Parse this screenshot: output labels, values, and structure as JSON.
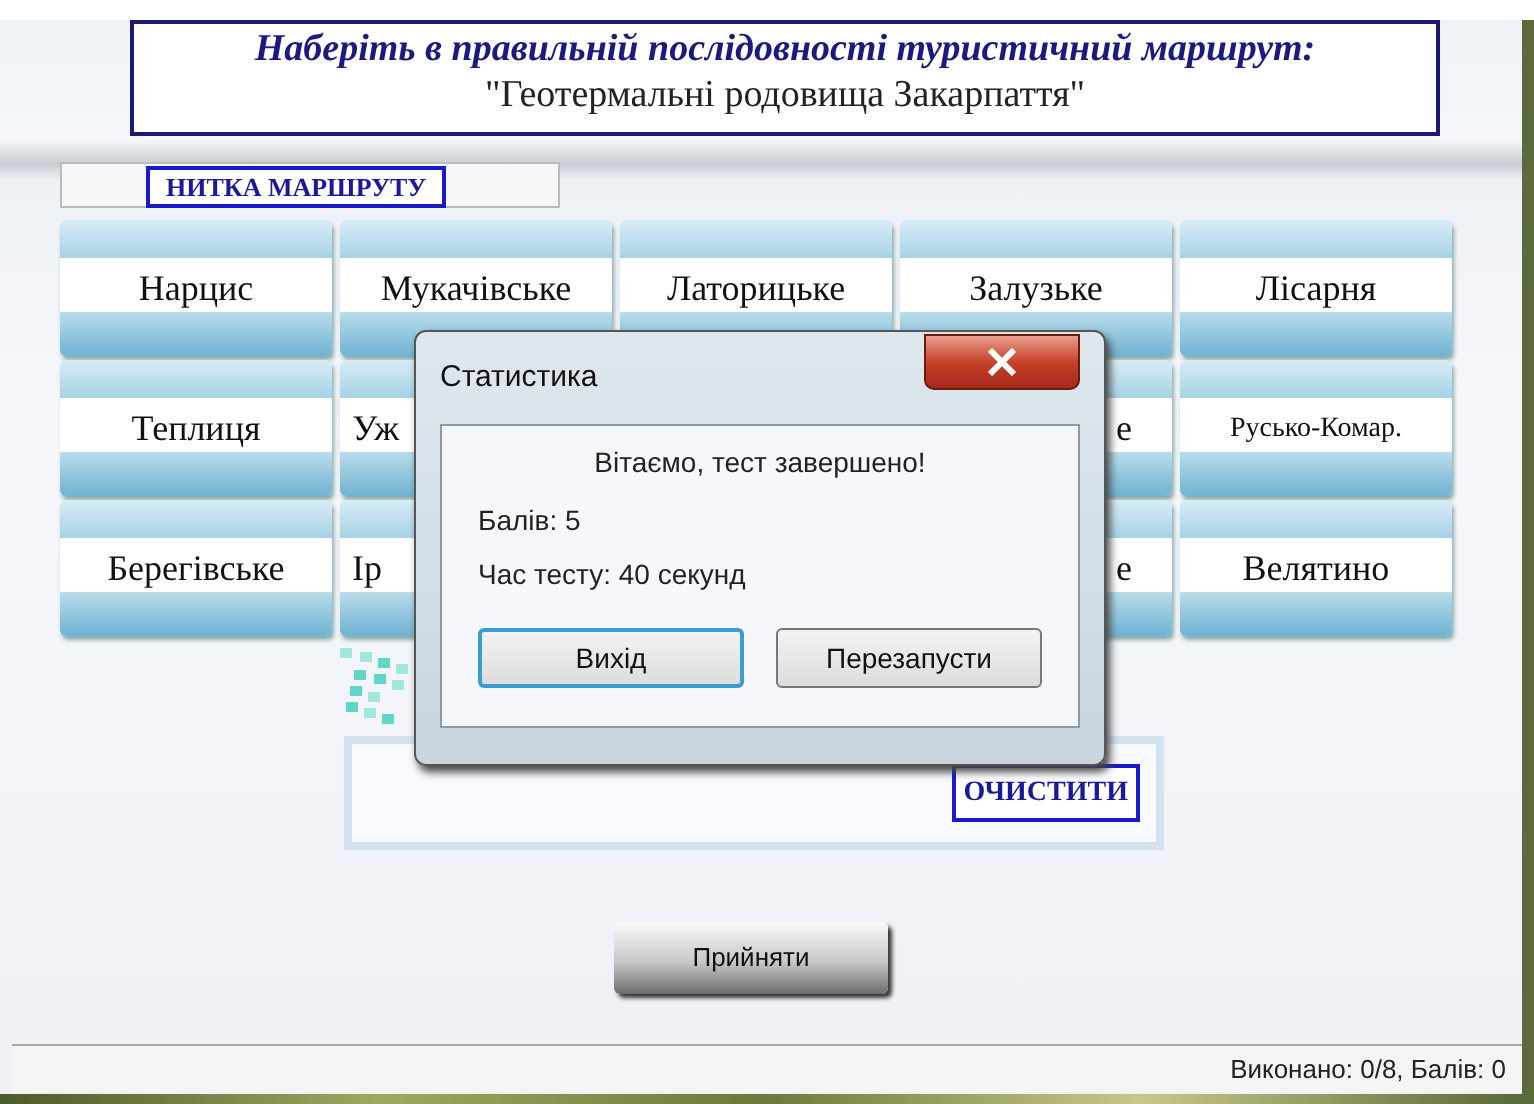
{
  "header": {
    "instruction": "Наберіть в правильній послідовності туристичний маршрут:",
    "topic": "\"Геотермальні родовища Закарпаття\""
  },
  "route": {
    "label": "НИТКА МАРШРУТУ"
  },
  "tiles": [
    {
      "kind": "full",
      "label": "Нарцис"
    },
    {
      "kind": "full",
      "label": "Мукачівське"
    },
    {
      "kind": "full",
      "label": "Латорицьке"
    },
    {
      "kind": "full",
      "label": "Залузьке"
    },
    {
      "kind": "full",
      "label": "Лісарня"
    },
    {
      "kind": "full",
      "label": "Теплиця"
    },
    {
      "kind": "cut",
      "label": "Уж"
    },
    {
      "kind": "covered"
    },
    {
      "kind": "edge",
      "label": "е"
    },
    {
      "kind": "full",
      "label": "Русько-Комар."
    },
    {
      "kind": "full",
      "label": "Берегівське"
    },
    {
      "kind": "cut",
      "label": "Ір"
    },
    {
      "kind": "covered"
    },
    {
      "kind": "edge",
      "label": "е"
    },
    {
      "kind": "full",
      "label": "Велятино"
    }
  ],
  "dialog": {
    "title": "Статистика",
    "message": "Вітаємо, тест завершено!",
    "lines": [
      "Балів: 5",
      "Час тесту: 40 секунд"
    ],
    "buttons": [
      {
        "label": "Вихід",
        "default": true
      },
      {
        "label": "Перезапусти",
        "default": false
      }
    ]
  },
  "clear_button": "ОЧИСТИТИ",
  "accept_button": "Прийняти",
  "status_bar": "Виконано: 0/8, Балів: 0"
}
